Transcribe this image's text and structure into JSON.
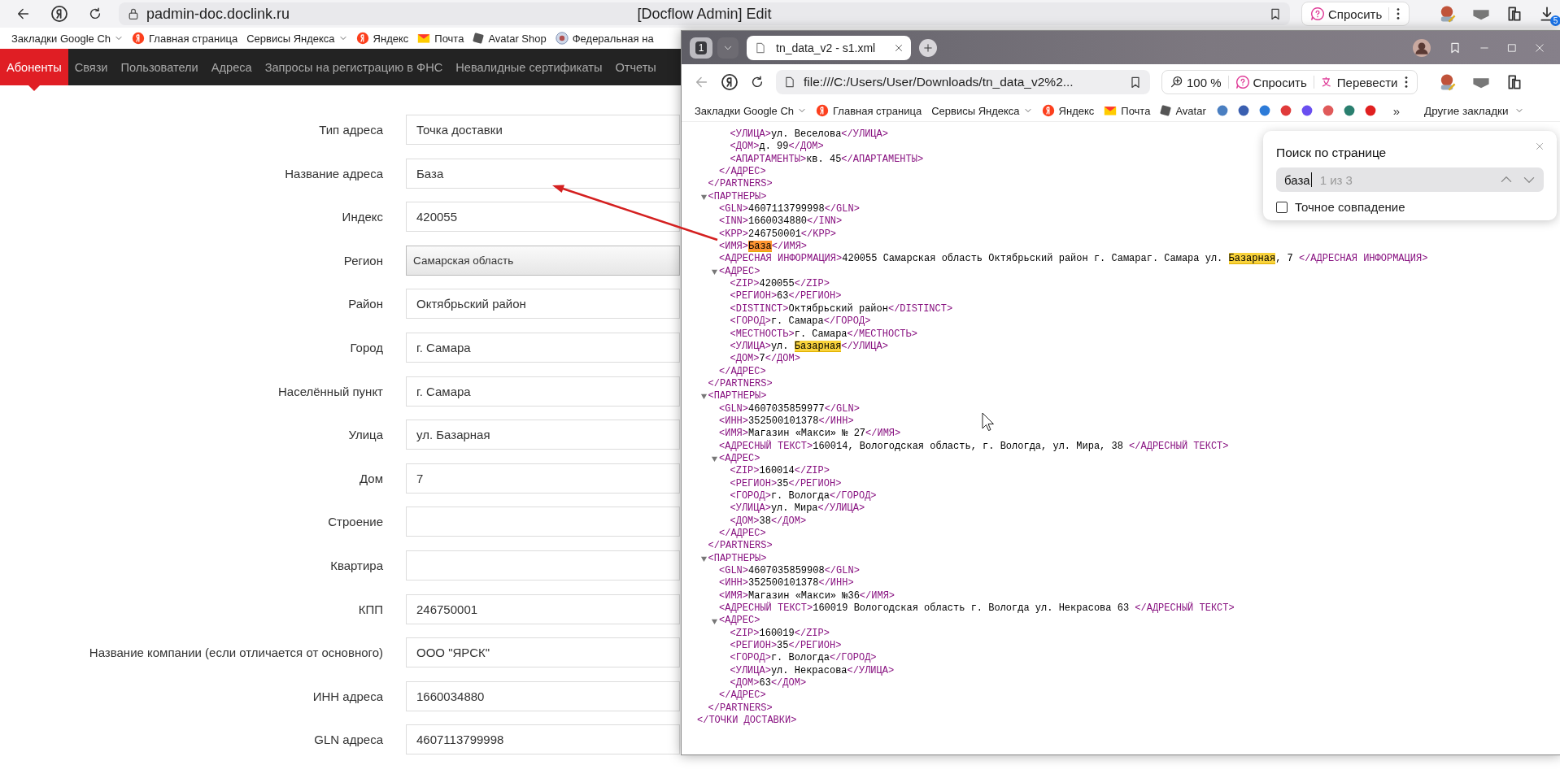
{
  "back_browser": {
    "address": "padmin-doc.doclink.ru",
    "title": "[Docflow Admin] Edit",
    "ask_button": "Спросить",
    "downloads_badge": "5",
    "bookmarks": [
      {
        "label": "Закладки Google Ch",
        "kind": "folder"
      },
      {
        "label": "Главная страница",
        "kind": "yandex"
      },
      {
        "label": "Сервисы Яндекса",
        "kind": "folder"
      },
      {
        "label": "Яндекс",
        "kind": "yandex"
      },
      {
        "label": "Почта",
        "kind": "mail"
      },
      {
        "label": "Avatar Shop",
        "kind": "avatar"
      },
      {
        "label": "Федеральная на",
        "kind": "emblem"
      }
    ]
  },
  "nav_tabs": [
    {
      "label": "Абоненты",
      "selected": true
    },
    {
      "label": "Связи",
      "selected": false
    },
    {
      "label": "Пользователи",
      "selected": false
    },
    {
      "label": "Адреса",
      "selected": false
    },
    {
      "label": "Запросы на регистрацию в ФНС",
      "selected": false
    },
    {
      "label": "Невалидные сертификаты",
      "selected": false
    },
    {
      "label": "Отчеты",
      "selected": false
    }
  ],
  "form": [
    {
      "label": "Тип адреса",
      "value": "Точка доставки",
      "kind": "text"
    },
    {
      "label": "Название адреса",
      "value": "База",
      "kind": "text"
    },
    {
      "label": "Индекс",
      "value": "420055",
      "kind": "text"
    },
    {
      "label": "Регион",
      "value": "Самарская область",
      "kind": "select"
    },
    {
      "label": "Район",
      "value": "Октябрьский район",
      "kind": "text"
    },
    {
      "label": "Город",
      "value": "г. Самара",
      "kind": "text"
    },
    {
      "label": "Населённый пункт",
      "value": "г. Самара",
      "kind": "text"
    },
    {
      "label": "Улица",
      "value": "ул. Базарная",
      "kind": "text"
    },
    {
      "label": "Дом",
      "value": "7",
      "kind": "text"
    },
    {
      "label": "Строение",
      "kind": "text"
    },
    {
      "label": "Квартира",
      "kind": "text"
    },
    {
      "label": "КПП",
      "value": "246750001",
      "kind": "text"
    },
    {
      "label": "Название компании (если отличается от основного)",
      "value": "ООО \"ЯРСК\"",
      "kind": "text"
    },
    {
      "label": "ИНН адреса",
      "value": "1660034880",
      "kind": "text"
    },
    {
      "label": "GLN адреса",
      "value": "4607113799998",
      "kind": "text"
    }
  ],
  "front_browser": {
    "tab_count": "1",
    "tab_title": "tn_data_v2 - s1.xml",
    "address": "file:///C:/Users/User/Downloads/tn_data_v2%2...",
    "zoom": "100 %",
    "ask_button": "Спросить",
    "translate_button": "Перевести",
    "bookmarks": [
      {
        "label": "Закладки Google Ch",
        "kind": "folder"
      },
      {
        "label": "Главная страница",
        "kind": "yandex"
      },
      {
        "label": "Сервисы Яндекса",
        "kind": "folder"
      },
      {
        "label": "Яндекс",
        "kind": "yandex"
      },
      {
        "label": "Почта",
        "kind": "mail"
      },
      {
        "label": "Avatar",
        "kind": "avatar"
      }
    ],
    "icon_bookmarks": [
      {
        "color": "#4a7fc1"
      },
      {
        "color": "#3a5fb0"
      },
      {
        "color": "#2d7bd8"
      },
      {
        "color": "#e03a3a"
      },
      {
        "color": "#6a4ff0"
      },
      {
        "color": "#e05a5a"
      },
      {
        "color": "#2a7f6f"
      },
      {
        "color": "#e02020"
      }
    ],
    "more_bookmarks": "»",
    "other_bookmarks": "Другие закладки"
  },
  "xml": {
    "close": "</ТОЧКИ ДОСТАВКИ>",
    "children": [
      {
        "close": "</PARTNERS>",
        "children": [
          {
            "close": "</АДРЕС>",
            "children": [
              {
                "open": "<УЛИЦА>",
                "text": "ул. Веселова",
                "close": "</УЛИЦА>"
              },
              {
                "open": "<ДОМ>",
                "text": "д. 99",
                "close": "</ДОМ>"
              },
              {
                "open": "<АПАРТАМЕНТЫ>",
                "text": "кв. 45",
                "close": "</АПАРТАМЕНТЫ>"
              }
            ]
          }
        ]
      },
      {
        "open": "<ПАРТНЕРЫ>",
        "close": "</PARTNERS>",
        "expanded": true,
        "children": [
          {
            "open": "<GLN>",
            "text": "4607113799998",
            "close": "</GLN>"
          },
          {
            "open": "<INN>",
            "text": "1660034880",
            "close": "</INN>"
          },
          {
            "open": "<KPP>",
            "text": "246750001",
            "close": "</KPP>"
          },
          {
            "open": "<ИМЯ>",
            "parts": [
              {
                "text": "База",
                "match": true,
                "current": true
              }
            ],
            "close": "</ИМЯ>"
          },
          {
            "open": "<АДРЕСНАЯ ИНФОРМАЦИЯ>",
            "parts": [
              {
                "text": "420055 Самарская область Октябрьский район г. Самараг. Самара ул. ",
                "match": false,
                "current": false
              },
              {
                "text": "Базарная",
                "match": true,
                "current": false
              },
              {
                "text": ", 7 ",
                "match": false,
                "current": false
              }
            ],
            "close": "</АДРЕСНАЯ ИНФОРМАЦИЯ>"
          },
          {
            "open": "<АДРЕС>",
            "close": "</АДРЕС>",
            "expanded": true,
            "children": [
              {
                "open": "<ZIP>",
                "text": "420055",
                "close": "</ZIP>"
              },
              {
                "open": "<РЕГИОН>",
                "text": "63",
                "close": "</РЕГИОН>"
              },
              {
                "open": "<DISTINCT>",
                "text": "Октябрьский район",
                "close": "</DISTINCT>"
              },
              {
                "open": "<ГОРОД>",
                "text": "г. Самара",
                "close": "</ГОРОД>"
              },
              {
                "open": "<МЕСТНОСТЬ>",
                "text": "г. Самара",
                "close": "</МЕСТНОСТЬ>"
              },
              {
                "open": "<УЛИЦА>",
                "parts": [
                  {
                    "text": "ул. ",
                    "match": false,
                    "current": false
                  },
                  {
                    "text": "Базарная",
                    "match": true,
                    "current": false
                  }
                ],
                "close": "</УЛИЦА>"
              },
              {
                "open": "<ДОМ>",
                "text": "7",
                "close": "</ДОМ>"
              }
            ]
          }
        ]
      },
      {
        "open": "<ПАРТНЕРЫ>",
        "close": "</PARTNERS>",
        "expanded": true,
        "children": [
          {
            "open": "<GLN>",
            "text": "4607035859977",
            "close": "</GLN>"
          },
          {
            "open": "<ИНН>",
            "text": "352500101378",
            "close": "</ИНН>"
          },
          {
            "open": "<ИМЯ>",
            "text": "Магазин «Макси» № 27",
            "close": "</ИМЯ>"
          },
          {
            "open": "<АДРЕСНЫЙ ТЕКСТ>",
            "text": "160014, Вологодская область, г. Вологда, ул. Мира, 38 ",
            "close": "</АДРЕСНЫЙ ТЕКСТ>"
          },
          {
            "open": "<АДРЕС>",
            "close": "</АДРЕС>",
            "expanded": true,
            "children": [
              {
                "open": "<ZIP>",
                "text": "160014",
                "close": "</ZIP>"
              },
              {
                "open": "<РЕГИОН>",
                "text": "35",
                "close": "</РЕГИОН>"
              },
              {
                "open": "<ГОРОД>",
                "text": "г. Вологда",
                "close": "</ГОРОД>"
              },
              {
                "open": "<УЛИЦА>",
                "text": "ул. Мира",
                "close": "</УЛИЦА>"
              },
              {
                "open": "<ДОМ>",
                "text": "38",
                "close": "</ДОМ>"
              }
            ]
          }
        ]
      },
      {
        "open": "<ПАРТНЕРЫ>",
        "close": "</PARTNERS>",
        "expanded": true,
        "children": [
          {
            "open": "<GLN>",
            "text": "4607035859908",
            "close": "</GLN>"
          },
          {
            "open": "<ИНН>",
            "text": "352500101378",
            "close": "</ИНН>"
          },
          {
            "open": "<ИМЯ>",
            "text": "Магазин «Макси» №36",
            "close": "</ИМЯ>"
          },
          {
            "open": "<АДРЕСНЫЙ ТЕКСТ>",
            "text": "160019 Вологодская область г. Вологда ул. Некрасова 63 ",
            "close": "</АДРЕСНЫЙ ТЕКСТ>"
          },
          {
            "open": "<АДРЕС>",
            "close": "</АДРЕС>",
            "expanded": true,
            "children": [
              {
                "open": "<ZIP>",
                "text": "160019",
                "close": "</ZIP>"
              },
              {
                "open": "<РЕГИОН>",
                "text": "35",
                "close": "</РЕГИОН>"
              },
              {
                "open": "<ГОРОД>",
                "text": "г. Вологда",
                "close": "</ГОРОД>"
              },
              {
                "open": "<УЛИЦА>",
                "text": "ул. Некрасова",
                "close": "</УЛИЦА>"
              },
              {
                "open": "<ДОМ>",
                "text": "63",
                "close": "</ДОМ>"
              }
            ]
          }
        ]
      }
    ]
  },
  "find_bar": {
    "title": "Поиск по странице",
    "query": "база",
    "count": "1 из 3",
    "exact_match": {
      "label": "Точное совпадение",
      "checked": false
    }
  }
}
